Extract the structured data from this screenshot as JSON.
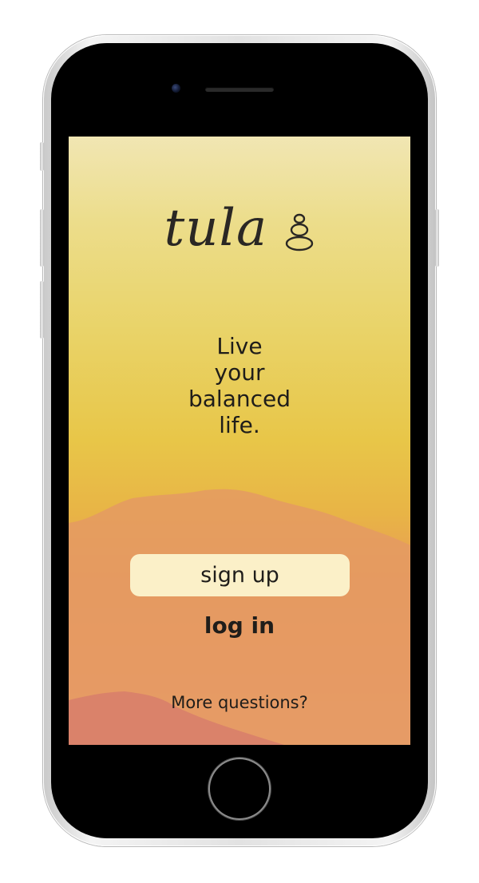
{
  "app": {
    "logo_text": "tula",
    "tagline": [
      "Live",
      "your",
      "balanced",
      "life."
    ],
    "signup_label": "sign up",
    "login_label": "log in",
    "more_label": "More questions?"
  },
  "icons": {
    "logo_mark": "stacked-stones-icon",
    "camera": "front-camera-icon",
    "home": "home-button-icon"
  },
  "colors": {
    "sky_top": "#f1e6b3",
    "sky_mid": "#e8c648",
    "mountain_far": "#e49a63",
    "mountain_near": "#d8806a",
    "button_bg": "#fbf0c8",
    "text": "#1f1d1a"
  }
}
